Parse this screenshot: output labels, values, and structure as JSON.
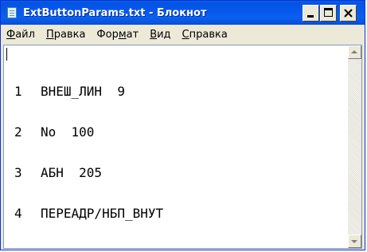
{
  "window": {
    "title": "ExtButtonParams.txt - Блокнот"
  },
  "menu": {
    "items": [
      {
        "label": "Файл"
      },
      {
        "label": "Правка"
      },
      {
        "label": "Формат"
      },
      {
        "label": "Вид"
      },
      {
        "label": "Справка"
      }
    ]
  },
  "document": {
    "lines": [
      {
        "num": "1",
        "text": "ВНЕШ_ЛИН  9"
      },
      {
        "num": "2",
        "text": "No  100"
      },
      {
        "num": "3",
        "text": "АБН  205"
      },
      {
        "num": "4",
        "text": "ПЕРЕАДР/НБП_ВНУТ"
      }
    ]
  },
  "icons": {
    "app": "notepad-icon",
    "minimize": "minimize-icon",
    "maximize": "maximize-icon",
    "close": "close-icon",
    "scroll_up": "scroll-up-arrow-icon",
    "scroll_down": "scroll-down-arrow-icon"
  },
  "colors": {
    "titlebar": "#0a5ee0",
    "chrome": "#ece9d8",
    "editor_border": "#7f9db9"
  }
}
